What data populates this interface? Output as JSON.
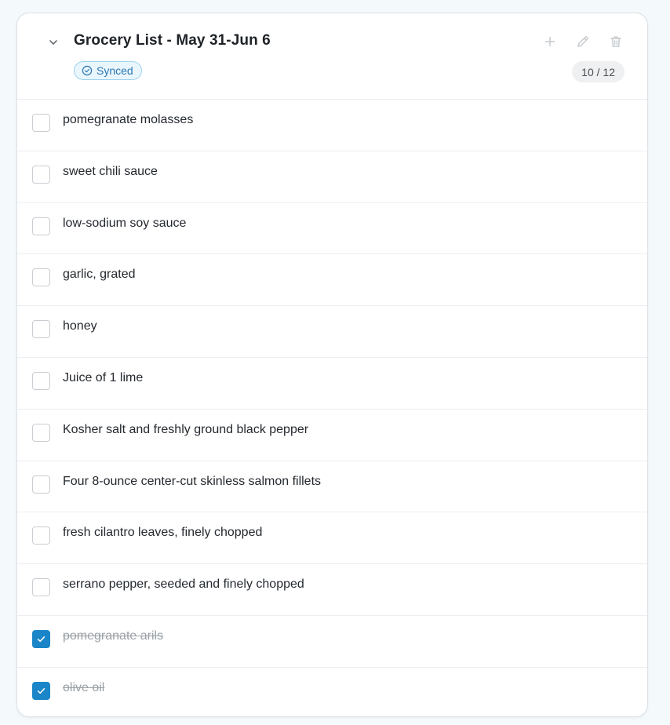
{
  "list": {
    "title": "Grocery List - May 31-Jun 6",
    "status": "Synced",
    "count": "10 / 12",
    "items": [
      {
        "label": "pomegranate molasses",
        "checked": false
      },
      {
        "label": "sweet chili sauce",
        "checked": false
      },
      {
        "label": "low-sodium soy sauce",
        "checked": false
      },
      {
        "label": "garlic, grated",
        "checked": false
      },
      {
        "label": "honey",
        "checked": false
      },
      {
        "label": "Juice of 1 lime",
        "checked": false
      },
      {
        "label": "Kosher salt and freshly ground black pepper",
        "checked": false
      },
      {
        "label": "Four 8-ounce center-cut skinless salmon fillets",
        "checked": false
      },
      {
        "label": "fresh cilantro leaves, finely chopped",
        "checked": false
      },
      {
        "label": "serrano pepper, seeded and finely chopped",
        "checked": false
      },
      {
        "label": "pomegranate arils",
        "checked": true
      },
      {
        "label": "olive oil",
        "checked": true
      }
    ]
  },
  "icons": {
    "collapse": "chevron-down-icon",
    "status": "check-circle-icon",
    "add": "plus-icon",
    "edit": "pencil-icon",
    "delete": "trash-icon",
    "check": "check-icon"
  },
  "colors": {
    "accent": "#1a86c8",
    "badge_text": "#2b78b5",
    "badge_bg": "#eaf6fd",
    "muted_icon": "#c4c8cc",
    "done_text": "#9aa0a6"
  }
}
